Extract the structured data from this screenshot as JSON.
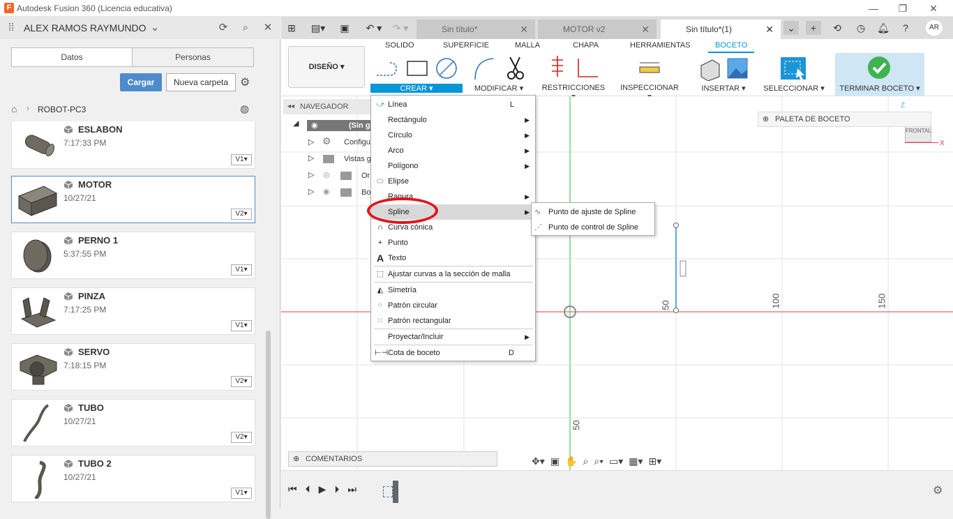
{
  "window": {
    "title": "Autodesk Fusion 360 (Licencia educativa)",
    "logo": "F"
  },
  "data_panel": {
    "user": "ALEX RAMOS RAYMUNDO",
    "tabs": [
      "Datos",
      "Personas"
    ],
    "upload_label": "Cargar",
    "new_folder_label": "Nueva carpeta",
    "breadcrumb": "ROBOT-PC3",
    "files": [
      {
        "name": "ESLABON",
        "time": "7:17:33 PM",
        "version": "V1▾"
      },
      {
        "name": "MOTOR",
        "time": "10/27/21",
        "version": "V2▾"
      },
      {
        "name": "PERNO 1",
        "time": "5:37:55 PM",
        "version": "V1▾"
      },
      {
        "name": "PINZA",
        "time": "7:17:25 PM",
        "version": "V1▾"
      },
      {
        "name": "SERVO",
        "time": "7:18:15 PM",
        "version": "V2▾"
      },
      {
        "name": "TUBO",
        "time": "10/27/21",
        "version": "V2▾"
      },
      {
        "name": "TUBO 2",
        "time": "10/27/21",
        "version": "V1▾"
      }
    ]
  },
  "doc_tabs": [
    {
      "label": "Sin título*",
      "close": "✕"
    },
    {
      "label": "MOTOR v2",
      "close": "✕"
    },
    {
      "label": "Sin título*(1)",
      "close": "✕"
    }
  ],
  "avatar": "AR",
  "ribbon": {
    "workspace": "DISEÑO ▾",
    "tabs": [
      "SOLIDO",
      "SUPERFICIE",
      "MALLA",
      "CHAPA",
      "HERRAMIENTAS",
      "BOCETO"
    ],
    "groups": [
      "CREAR ▾",
      "MODIFICAR ▾",
      "RESTRICCIONES ▾",
      "INSPECCIONAR ▾",
      "INSERTAR ▾",
      "SELECCIONAR ▾",
      "TERMINAR BOCETO ▾"
    ]
  },
  "browser": {
    "title": "NAVEGADOR",
    "rows": [
      "(Sin g",
      "Configu",
      "Vistas g",
      "Or",
      "Bo"
    ]
  },
  "crear_menu": {
    "items": [
      {
        "label": "Línea",
        "shortcut": "L",
        "arrow": ""
      },
      {
        "label": "Rectángulo",
        "shortcut": "",
        "arrow": "▶"
      },
      {
        "label": "Círculo",
        "shortcut": "",
        "arrow": "▶"
      },
      {
        "label": "Arco",
        "shortcut": "",
        "arrow": "▶"
      },
      {
        "label": "Polígono",
        "shortcut": "",
        "arrow": "▶"
      },
      {
        "label": "Elipse",
        "shortcut": "",
        "arrow": ""
      },
      {
        "label": "Ranura",
        "shortcut": "",
        "arrow": "▶"
      },
      {
        "label": "Spline",
        "shortcut": "",
        "arrow": "▶"
      },
      {
        "label": "Curva cónica",
        "shortcut": "",
        "arrow": ""
      },
      {
        "label": "Punto",
        "shortcut": "",
        "arrow": ""
      },
      {
        "label": "Texto",
        "shortcut": "",
        "arrow": ""
      },
      {
        "label": "Ajustar curvas a la sección de malla",
        "shortcut": "",
        "arrow": ""
      },
      {
        "label": "Simetría",
        "shortcut": "",
        "arrow": ""
      },
      {
        "label": "Patrón circular",
        "shortcut": "",
        "arrow": ""
      },
      {
        "label": "Patrón rectangular",
        "shortcut": "",
        "arrow": ""
      },
      {
        "label": "Proyectar/Incluir",
        "shortcut": "",
        "arrow": "▶"
      },
      {
        "label": "Cota de boceto",
        "shortcut": "D",
        "arrow": ""
      }
    ],
    "spline_submenu": [
      "Punto de ajuste de Spline",
      "Punto de control de Spline"
    ]
  },
  "canvas": {
    "palette_label": "PALETA DE BOCETO",
    "viewcube_label": "FRONTAL",
    "axis_z": "Z",
    "axis_x": "X",
    "ruler_marks": [
      "50",
      "100",
      "150",
      "50"
    ],
    "comments_label": "COMENTARIOS"
  }
}
